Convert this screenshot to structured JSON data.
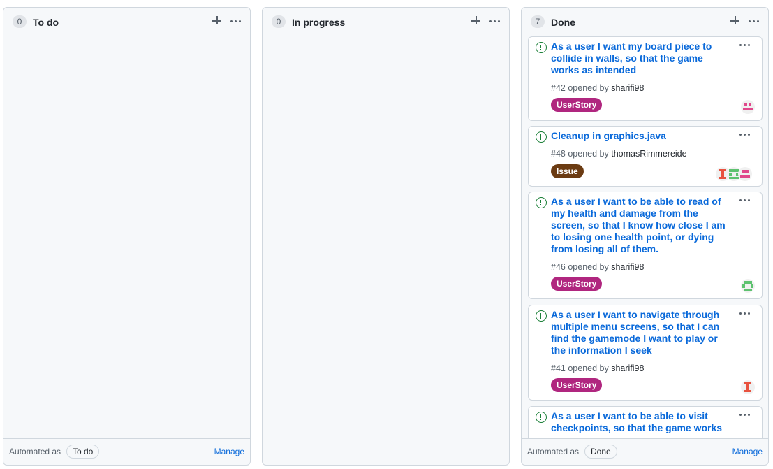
{
  "columns": [
    {
      "count": "0",
      "title": "To do",
      "automated_label": "Automated as",
      "automated_value": "To do",
      "manage": "Manage"
    },
    {
      "count": "0",
      "title": "In progress"
    },
    {
      "count": "7",
      "title": "Done",
      "automated_label": "Automated as",
      "automated_value": "Done",
      "manage": "Manage"
    }
  ],
  "cards": [
    {
      "title": "As a user I want my board piece to collide in walls, so that the game works as intended",
      "number": "#42",
      "opened_by": "opened by",
      "author": "sharifi98",
      "label": "UserStory",
      "label_color": "#b0267f",
      "avatars": [
        "pink-identicon-avatar"
      ]
    },
    {
      "title": "Cleanup in graphics.java",
      "number": "#48",
      "opened_by": "opened by",
      "author": "thomasRimmereide",
      "label": "Issue",
      "label_color": "#6b3b12",
      "avatars": [
        "red-identicon-avatar",
        "green-identicon-avatar",
        "pink-identicon-avatar"
      ]
    },
    {
      "title": "As a user I want to be able to read of my health and damage from the screen, so that I know how close I am to losing one health point, or dying from losing all of them.",
      "number": "#46",
      "opened_by": "opened by",
      "author": "sharifi98",
      "label": "UserStory",
      "label_color": "#b0267f",
      "avatars": [
        "green-identicon-avatar"
      ]
    },
    {
      "title": "As a user I want to navigate through multiple menu screens, so that I can find the gamemode I want to play or the information I seek",
      "number": "#41",
      "opened_by": "opened by",
      "author": "sharifi98",
      "label": "UserStory",
      "label_color": "#b0267f",
      "avatars": [
        "red-identicon-avatar"
      ]
    },
    {
      "title": "As a user I want to be able to visit checkpoints, so that the game works"
    }
  ],
  "colors": {
    "link": "#0969da",
    "open_status": "#1a7f37",
    "column_bg": "#f6f8fa",
    "border": "#d0d7de"
  }
}
